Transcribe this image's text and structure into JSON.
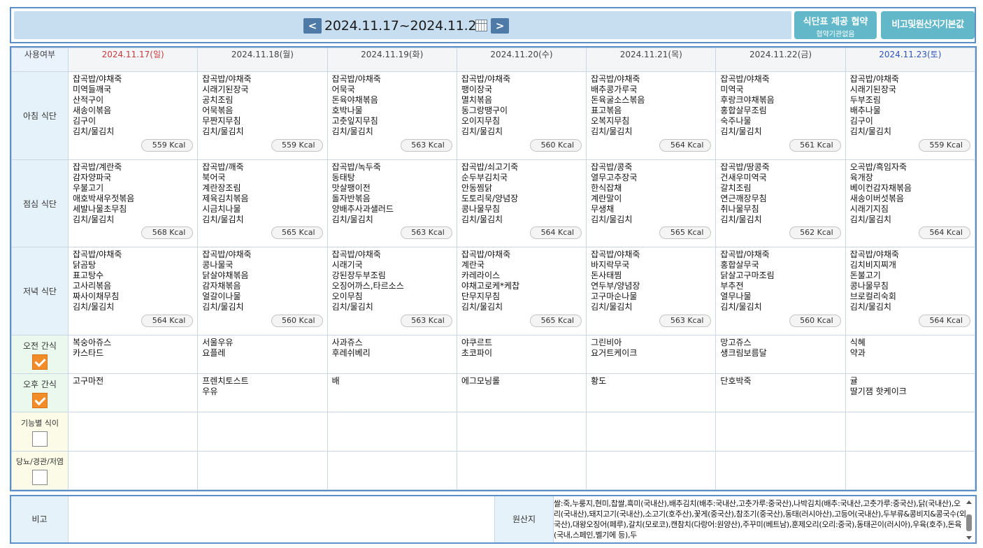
{
  "header": {
    "date_range": "2024.11.17~2024.11.23",
    "prev_label": "<",
    "next_label": ">",
    "agree_button": {
      "title": "식단표 제공 협약",
      "sub": "협약기관없음"
    },
    "note_button": "비고및원산지기본값"
  },
  "grid": {
    "corner_label": "사용여부",
    "days": [
      {
        "label": "2024.11.17(일)",
        "type": "sun"
      },
      {
        "label": "2024.11.18(월)",
        "type": "weekday"
      },
      {
        "label": "2024.11.19(화)",
        "type": "weekday"
      },
      {
        "label": "2024.11.20(수)",
        "type": "weekday"
      },
      {
        "label": "2024.11.21(목)",
        "type": "weekday"
      },
      {
        "label": "2024.11.22(금)",
        "type": "weekday"
      },
      {
        "label": "2024.11.23(토)",
        "type": "sat"
      }
    ],
    "meals": [
      {
        "label": "아침 식단",
        "cells": [
          {
            "items": [
              "잡곡밥/야채죽",
              "미역들깨국",
              "산적구이",
              "새송이볶음",
              "김구이",
              "김치/물김치"
            ],
            "kcal": "559 Kcal"
          },
          {
            "items": [
              "잡곡밥/야채죽",
              "시래기된장국",
              "공치조림",
              "어묵볶음",
              "무짠지무침",
              "김치/물김치"
            ],
            "kcal": "559 Kcal"
          },
          {
            "items": [
              "잡곡밥/야채죽",
              "어묵국",
              "돈육야채볶음",
              "호박나물",
              "고춧잎지무침",
              "김치/물김치"
            ],
            "kcal": "563 Kcal"
          },
          {
            "items": [
              "잡곡밥/야채죽",
              "팽이장국",
              "멸치볶음",
              "동그랑땡구이",
              "오이지무침",
              "김치/물김치"
            ],
            "kcal": "560 Kcal"
          },
          {
            "items": [
              "잡곡밥/야채죽",
              "배추콩가루국",
              "돈육굴소스볶음",
              "표고볶음",
              "오복지무침",
              "김치/물김치"
            ],
            "kcal": "564 Kcal"
          },
          {
            "items": [
              "잡곡밥/야채죽",
              "미역국",
              "후랑크야채볶음",
              "홍합살무조림",
              "숙주나물",
              "김치/물김치"
            ],
            "kcal": "561 Kcal"
          },
          {
            "items": [
              "잡곡밥/야채죽",
              "시래기된장국",
              "두부조림",
              "배추나물",
              "김구이",
              "김치/물김치"
            ],
            "kcal": "559 Kcal"
          }
        ]
      },
      {
        "label": "점심 식단",
        "cells": [
          {
            "items": [
              "잡곡밥/계란죽",
              "감자양파국",
              "우불고기",
              "애호박새우젓볶음",
              "세발나물초무침",
              "김치/물김치"
            ],
            "kcal": "568 Kcal"
          },
          {
            "items": [
              "잡곡밥/깨죽",
              "북어국",
              "계란장조림",
              "제육김치볶음",
              "시금치나물",
              "김치/물김치"
            ],
            "kcal": "565 Kcal"
          },
          {
            "items": [
              "잡곡밥/녹두죽",
              "동태탕",
              "맛살팽이전",
              "돌자반볶음",
              "양배추사과샐러드",
              "김치/물김치"
            ],
            "kcal": "563 Kcal"
          },
          {
            "items": [
              "잡곡밥/쇠고기죽",
              "순두부김치국",
              "안동찜닭",
              "도토리묵/양념장",
              "콩나물무침",
              "김치/물김치"
            ],
            "kcal": "564 Kcal"
          },
          {
            "items": [
              "잡곡밥/콩죽",
              "열무고추장국",
              "한식잡채",
              "계란말이",
              "무생채",
              "김치/물김치"
            ],
            "kcal": "565 Kcal"
          },
          {
            "items": [
              "잡곡밥/땅콩죽",
              "건새우미역국",
              "갈치조림",
              "연근깨장무침",
              "취나물무침",
              "김치/물김치"
            ],
            "kcal": "562 Kcal"
          },
          {
            "items": [
              "오곡밥/흑임자죽",
              "육개장",
              "베이컨감자채볶음",
              "새송이버섯볶음",
              "시래기지짐",
              "김치/물김치"
            ],
            "kcal": "564 Kcal"
          }
        ]
      },
      {
        "label": "저녁 식단",
        "cells": [
          {
            "items": [
              "잡곡밥/야채죽",
              "닭곰탕",
              "표고탕수",
              "고사리볶음",
              "짜사이채무침",
              "김치/물김치"
            ],
            "kcal": "564 Kcal"
          },
          {
            "items": [
              "잡곡밥/야채죽",
              "콩나물국",
              "닭살야채볶음",
              "감자채볶음",
              "얼갈이나물",
              "김치/물김치"
            ],
            "kcal": "560 Kcal"
          },
          {
            "items": [
              "잡곡밥/야채죽",
              "시래기국",
              "강된장두부조림",
              "오징어까스,타르소스",
              "오이무침",
              "김치/물김치"
            ],
            "kcal": "563 Kcal"
          },
          {
            "items": [
              "잡곡밥/야채죽",
              "계란국",
              "카레라이스",
              "야채고로케*케찹",
              "단무지무침",
              "김치/물김치"
            ],
            "kcal": "565 Kcal"
          },
          {
            "items": [
              "잡곡밥/야채죽",
              "바지락무국",
              "돈사태찜",
              "연두부/양념장",
              "고구마순나물",
              "김치/물김치"
            ],
            "kcal": "563 Kcal"
          },
          {
            "items": [
              "잡곡밥/야채죽",
              "홍합살무국",
              "닭살고구마조림",
              "부추전",
              "열무나물",
              "김치/물김치"
            ],
            "kcal": "560 Kcal"
          },
          {
            "items": [
              "잡곡밥/야채죽",
              "김치비지찌개",
              "돈불고기",
              "콩나물무침",
              "브로컬리숙회",
              "김치/물김치"
            ],
            "kcal": "564 Kcal"
          }
        ]
      }
    ],
    "snacks": [
      {
        "label": "오전 간식",
        "checked": true,
        "cells": [
          [
            "복숭아쥬스",
            "카스타드"
          ],
          [
            "서울우유",
            "요플레"
          ],
          [
            "사과쥬스",
            "후레쉬베리"
          ],
          [
            "야쿠르트",
            "초코파이"
          ],
          [
            "그린비아",
            "요거트케이크"
          ],
          [
            "망고쥬스",
            "생크림보름달"
          ],
          [
            "식혜",
            "약과"
          ]
        ]
      },
      {
        "label": "오후 간식",
        "checked": true,
        "cells": [
          [
            "고구마전"
          ],
          [
            "프렌치토스트",
            "우유"
          ],
          [
            "배"
          ],
          [
            "에그모닝롤"
          ],
          [
            "황도"
          ],
          [
            "단호박죽"
          ],
          [
            "귤",
            "딸기잼 핫케이크"
          ]
        ]
      }
    ],
    "special": [
      {
        "label": "기능별 식이",
        "checked": false
      },
      {
        "label": "당뇨/경관/저염",
        "checked": false
      }
    ]
  },
  "footer": {
    "note_label": "비고",
    "note_value": "",
    "origin_label": "원산지",
    "origin_text": "쌀:죽,누룽지,현미,찹쌀,흑미(국내산),배추김치(배추:국내산,고춧가루:중국산),나박김치(배추:국내산,고춧가루:중국산),닭(국내산),오리(국내산),돼지고기(국내산),소고기(호주산),꽃게(중국산),참조기(중국산),동태(러시아산),고등어(국내산),두부류&콩비지&콩국수(외국산),대왕오징어(페루),갈치(모로코),캔참치(다랑어:원양산),주꾸미(베트남),훈제오리(오리:중국),동태곤이(러시아),우육(호주),돈육(국내,스페인,벨기에 등),두"
  },
  "colors": {
    "accent": "#5b8fc7",
    "button": "#62b8c9",
    "sunday": "#c83a3a",
    "saturday": "#2e55b8",
    "check": "#f28c28"
  }
}
